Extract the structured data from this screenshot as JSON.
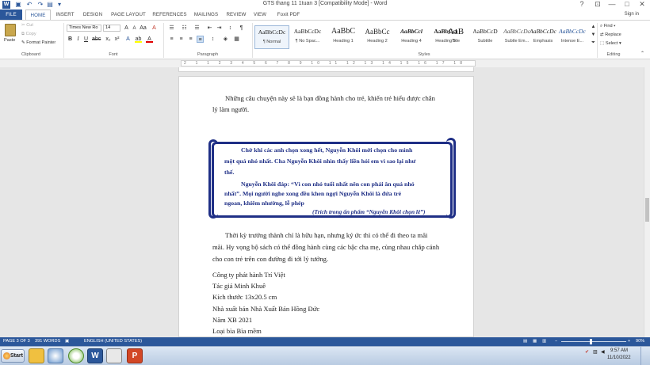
{
  "window": {
    "title": "GTS thang 11 1tuan 3 [Compatibility Mode] - Word",
    "help": "?",
    "minimize": "—",
    "maximize": "□",
    "close": "✕"
  },
  "tabs": [
    "FILE",
    "HOME",
    "INSERT",
    "DESIGN",
    "PAGE LAYOUT",
    "REFERENCES",
    "MAILINGS",
    "REVIEW",
    "VIEW",
    "Foxit PDF"
  ],
  "sign_in": "Sign in",
  "clipboard": {
    "paste": "Paste",
    "cut": "Cut",
    "copy": "Copy",
    "format_painter": "Format Painter",
    "label": "Clipboard"
  },
  "font": {
    "name": "Times New Ro",
    "size": "14",
    "label": "Font"
  },
  "paragraph": {
    "label": "Paragraph"
  },
  "styles": {
    "label": "Styles",
    "items": [
      {
        "preview": "AaBbCcDc",
        "name": "¶ Normal"
      },
      {
        "preview": "AaBbCcDc",
        "name": "¶ No Spac..."
      },
      {
        "preview": "AaBbC",
        "name": "Heading 1"
      },
      {
        "preview": "AaBbCc",
        "name": "Heading 2"
      },
      {
        "preview": "AaBbCcl",
        "name": "Heading 4"
      },
      {
        "preview": "AaBbCcl",
        "name": "Heading 5"
      },
      {
        "preview": "AaB",
        "name": "Title"
      },
      {
        "preview": "AaBbCcD",
        "name": "Subtitle"
      },
      {
        "preview": "AaBbCcDc",
        "name": "Subtle Em..."
      },
      {
        "preview": "AaBbCcDc",
        "name": "Emphasis"
      },
      {
        "preview": "AaBbCcDc",
        "name": "Intense E..."
      }
    ]
  },
  "editing": {
    "find": "Find",
    "replace": "Replace",
    "select": "Select",
    "label": "Editing"
  },
  "ruler_numbers": "2 1 1 2 3 4 5 6 7 8 9 10 11 12 13 14 15 16 17 18",
  "document": {
    "intro_1": "Những câu chuyện này sẽ là bạn đồng hành cho trẻ, khiến trẻ hiểu được chân",
    "intro_2": "lý làm người.",
    "scroll_lines": [
      "Chờ khi các anh chọn xong hết, Nguyễn Khôi mới chọn cho mình",
      "một quả nhỏ nhất. Cha Nguyễn Khôi nhìn thấy liền hỏi em vì sao lại như",
      "thế.",
      "Nguyễn Khôi đáp: “Vì con nhỏ tuổi nhất nên con phải ăn quả nhỏ",
      "nhất”. Mọi người nghe xong đều khen ngợi Nguyễn Khôi là đứa trẻ",
      "ngoan, khiêm nhường, lễ phép"
    ],
    "scroll_citation": "(Trích trong ấn phẩm “Nguyễn Khôi chọn lê”)",
    "body_1": "Thời kỳ trưởng thành chỉ là hữu hạn, nhưng ký ức thì có thể đi theo ta mãi",
    "body_2": "mãi. Hy vọng bộ sách có thể đồng hành cùng các bậc cha mẹ, cùng nhau chắp cánh",
    "body_3": "cho con trẻ trên con đường đi tới lý tưởng.",
    "details": [
      "Công ty phát hành Trí Việt",
      "Tác giả Minh Khuê",
      "Kích thước 13x20.5 cm",
      "Nhà xuất bản Nhà Xuất Bản Hồng Đức",
      "Năm XB 2021",
      "Loại bìa Bìa mềm"
    ]
  },
  "status": {
    "page": "PAGE 3 OF 3",
    "words": "391 WORDS",
    "language": "ENGLISH (UNITED STATES)",
    "zoom": "90%",
    "zoom_level": 0.9
  },
  "taskbar": {
    "start": "Start",
    "time": "9:57 AM",
    "date": "11/10/2022"
  },
  "colors": {
    "accent": "#2b579a",
    "scroll_blue": "#1f2f86"
  }
}
